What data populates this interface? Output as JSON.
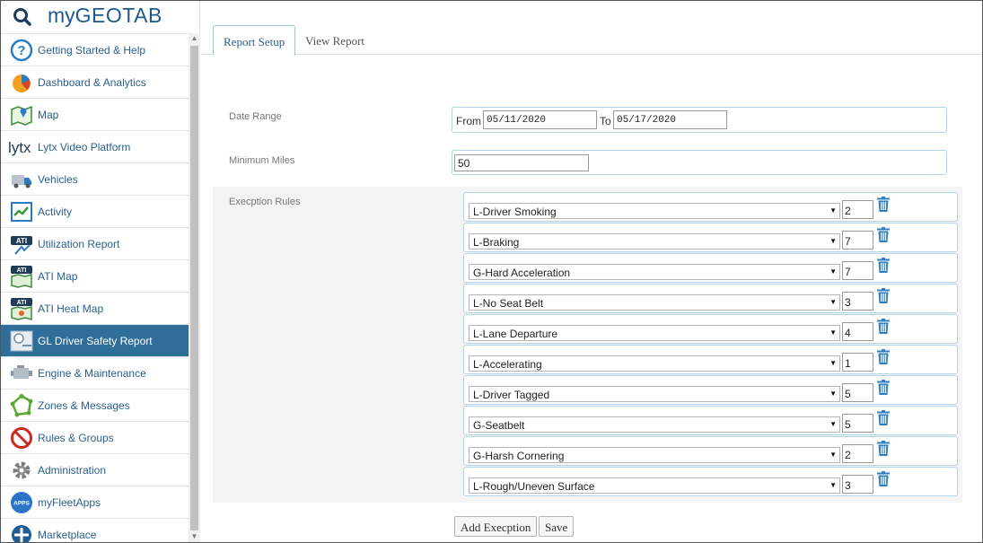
{
  "app": {
    "logo_my": "my",
    "logo_geotab": "GEOTAB"
  },
  "sidebar": {
    "items": [
      {
        "label": "Getting Started & Help",
        "icon": "help-icon"
      },
      {
        "label": "Dashboard & Analytics",
        "icon": "pie-chart-icon"
      },
      {
        "label": "Map",
        "icon": "map-icon"
      },
      {
        "label": "Lytx Video Platform",
        "icon": "lytx-logo-icon"
      },
      {
        "label": "Vehicles",
        "icon": "truck-icon"
      },
      {
        "label": "Activity",
        "icon": "activity-chart-icon"
      },
      {
        "label": "Utilization Report",
        "icon": "ati-logo-icon"
      },
      {
        "label": "ATI Map",
        "icon": "ati-map-icon"
      },
      {
        "label": "ATI Heat Map",
        "icon": "ati-heat-map-icon"
      },
      {
        "label": "GL Driver Safety Report",
        "icon": "driver-safety-icon"
      },
      {
        "label": "Engine & Maintenance",
        "icon": "engine-icon"
      },
      {
        "label": "Zones & Messages",
        "icon": "zones-icon"
      },
      {
        "label": "Rules & Groups",
        "icon": "rules-icon"
      },
      {
        "label": "Administration",
        "icon": "gear-icon"
      },
      {
        "label": "myFleetApps",
        "icon": "apps-icon"
      },
      {
        "label": "Marketplace",
        "icon": "marketplace-icon"
      }
    ],
    "active_index": 9
  },
  "tabs": [
    {
      "label": "Report Setup",
      "active": true
    },
    {
      "label": "View Report",
      "active": false
    }
  ],
  "form": {
    "date_range_label": "Date Range",
    "from_label": "From",
    "from_value": "05/11/2020",
    "to_label": "To",
    "to_value": "05/17/2020",
    "min_miles_label": "Minimum Miles",
    "min_miles_value": "50",
    "rules_label": "Execption Rules",
    "rules": [
      {
        "name": "L-Driver Smoking",
        "value": "2"
      },
      {
        "name": "L-Braking",
        "value": "7"
      },
      {
        "name": "G-Hard Acceleration",
        "value": "7"
      },
      {
        "name": "L-No Seat Belt",
        "value": "3"
      },
      {
        "name": "L-Lane Departure",
        "value": "4"
      },
      {
        "name": "L-Accelerating",
        "value": "1"
      },
      {
        "name": "L-Driver Tagged",
        "value": "5"
      },
      {
        "name": "G-Seatbelt",
        "value": "5"
      },
      {
        "name": "G-Harsh Cornering",
        "value": "2"
      },
      {
        "name": "L-Rough/Uneven Surface",
        "value": "3"
      }
    ],
    "add_button": "Add Execption",
    "save_button": "Save"
  },
  "colors": {
    "brand": "#1d5a91",
    "active_nav": "#2f6e99",
    "trash": "#2f7fc1"
  }
}
